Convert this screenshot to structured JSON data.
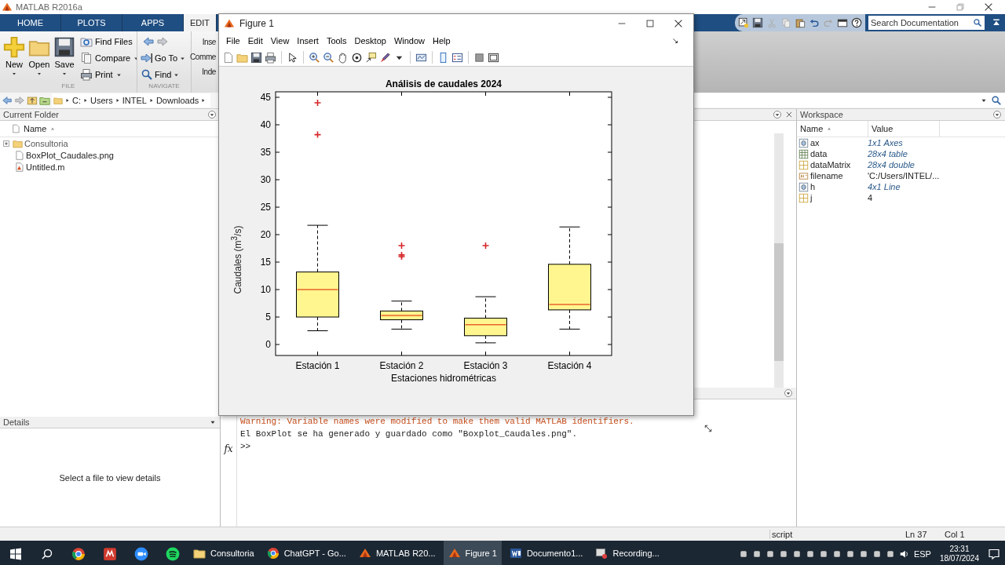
{
  "app_title": "MATLAB R2016a",
  "ribbon_tabs": [
    {
      "label": "HOME",
      "selected": false
    },
    {
      "label": "PLOTS",
      "selected": false
    },
    {
      "label": "APPS",
      "selected": false
    },
    {
      "label": "EDIT",
      "selected": true
    }
  ],
  "search": {
    "placeholder": "Search Documentation"
  },
  "toolstrip": {
    "sections": [
      {
        "label": "FILE",
        "large_buttons": [
          {
            "label": "New",
            "kind": "new"
          },
          {
            "label": "Open",
            "kind": "open"
          },
          {
            "label": "Save",
            "kind": "save"
          }
        ],
        "small_buttons": [
          {
            "label": "Find Files",
            "kind": "find-files",
            "dropdown": false
          },
          {
            "label": "Compare",
            "kind": "compare",
            "dropdown": true
          },
          {
            "label": "Print",
            "kind": "print",
            "dropdown": true
          }
        ]
      },
      {
        "label": "NAVIGATE",
        "small_buttons": [
          {
            "label": "Go To",
            "kind": "goto",
            "dropdown": true
          },
          {
            "label": "Find",
            "kind": "find",
            "dropdown": true
          }
        ]
      }
    ],
    "cut_labels": [
      "Inse",
      "Comme",
      "Inde"
    ]
  },
  "address_path": [
    "C:",
    "Users",
    "INTEL",
    "Downloads"
  ],
  "current_folder": {
    "title": "Current Folder",
    "column": "Name",
    "items": [
      {
        "name": "Consultoria",
        "kind": "folder"
      },
      {
        "name": "BoxPlot_Caudales.png",
        "kind": "image"
      },
      {
        "name": "Untitled.m",
        "kind": "script"
      }
    ]
  },
  "details": {
    "title": "Details",
    "message": "Select a file to view details"
  },
  "command_window": {
    "lines": [
      {
        "text": "Warning: Variable names were modified to make them valid MATLAB identifiers.",
        "kind": "warning"
      },
      {
        "text": "El BoxPlot se ha generado y guardado como \"Boxplot_Caudales.png\".",
        "kind": "output"
      }
    ],
    "prompt": ">>",
    "function_label": "fx"
  },
  "workspace": {
    "title": "Workspace",
    "columns": [
      "Name",
      "Value"
    ],
    "rows": [
      {
        "name": "ax",
        "value": "1x1 Axes",
        "kind": "object"
      },
      {
        "name": "data",
        "value": "28x4 table",
        "kind": "table"
      },
      {
        "name": "dataMatrix",
        "value": "28x4 double",
        "kind": "matrix"
      },
      {
        "name": "filename",
        "value": "'C:/Users/INTEL/...",
        "kind": "text"
      },
      {
        "name": "h",
        "value": "4x1 Line",
        "kind": "object"
      },
      {
        "name": "j",
        "value": "4",
        "kind": "scalar"
      }
    ]
  },
  "status_bar": {
    "mode": "script",
    "line": "Ln 37",
    "column": "Col 1"
  },
  "figure": {
    "title": "Figure 1",
    "menu": [
      "File",
      "Edit",
      "View",
      "Insert",
      "Tools",
      "Desktop",
      "Window",
      "Help"
    ],
    "chart_data": {
      "type": "scatter",
      "title": "Análisis de caudales 2024",
      "xlabel": "Estaciones hidrométricas",
      "ylabel": "Caudales (m$^{3}$/s)",
      "categories": [
        "Estación 1",
        "Estación 2",
        "Estación 3",
        "Estación 4"
      ],
      "ylim": [
        -2,
        46
      ],
      "yticks": [
        0,
        5,
        10,
        15,
        20,
        25,
        30,
        35,
        40,
        45
      ],
      "series": [
        {
          "color": "#d62728",
          "values": [
            44,
            18,
            18,
            null
          ]
        },
        {
          "color": "#d62728",
          "values": [
            38.2,
            16.3,
            null,
            null
          ]
        },
        {
          "color": "#d62728",
          "values": [
            null,
            16,
            null,
            null
          ]
        }
      ]
    }
  },
  "taskbar": {
    "apps": [
      {
        "label": "Consultoria",
        "kind": "folder",
        "selected": false
      },
      {
        "label": "ChatGPT - Go...",
        "kind": "browser",
        "selected": false
      },
      {
        "label": "MATLAB R20...",
        "kind": "matlab",
        "selected": false
      },
      {
        "label": "Figure 1",
        "kind": "figure",
        "selected": true
      },
      {
        "label": "Documento1...",
        "kind": "word",
        "selected": false
      },
      {
        "label": "Recording...",
        "kind": "recorder",
        "selected": false
      }
    ],
    "language": "ESP",
    "time": "23:31",
    "date": "18/07/2024"
  }
}
